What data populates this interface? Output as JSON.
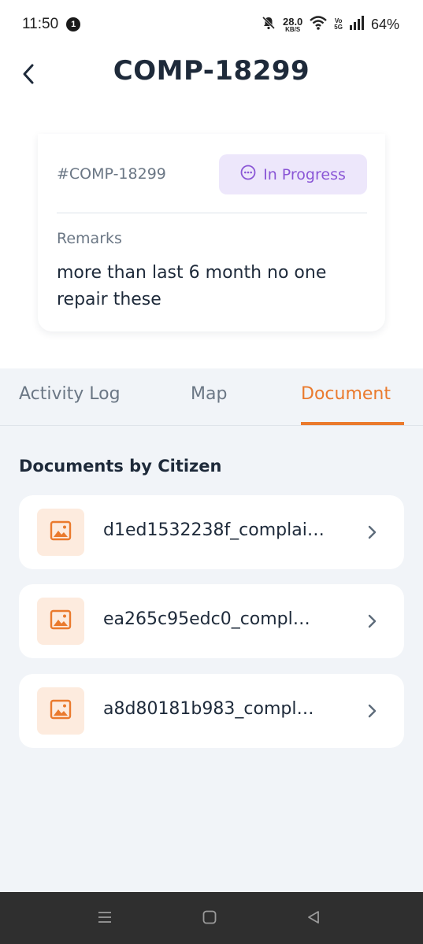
{
  "status_bar": {
    "time": "11:50",
    "notification_count": "1",
    "net_speed_value": "28.0",
    "net_speed_unit": "KB/S",
    "volte_top": "Vo",
    "volte_bottom": "5G",
    "battery": "64%"
  },
  "header": {
    "title": "COMP-18299",
    "back_icon": "chevron-left-icon"
  },
  "complaint": {
    "id": "#COMP-18299",
    "status": "In Progress",
    "status_icon": "dots-circle-icon",
    "status_color": "#8a56d6",
    "status_bg": "#ede7fb",
    "remarks_label": "Remarks",
    "remarks": "more than last 6 month no one repair these"
  },
  "tabs": [
    {
      "label": "Activity Log",
      "active": false
    },
    {
      "label": "Map",
      "active": false
    },
    {
      "label": "Document",
      "active": true
    }
  ],
  "accent_color": "#ea7a2d",
  "documents": {
    "heading": "Documents by Citizen",
    "items": [
      {
        "name": "d1ed1532238f_complai…",
        "icon": "image-icon"
      },
      {
        "name": "ea265c95edc0_compl…",
        "icon": "image-icon"
      },
      {
        "name": "a8d80181b983_compl…",
        "icon": "image-icon"
      }
    ]
  },
  "nav": {
    "menu_icon": "menu-icon",
    "home_icon": "home-square-icon",
    "back_icon": "back-triangle-icon"
  }
}
